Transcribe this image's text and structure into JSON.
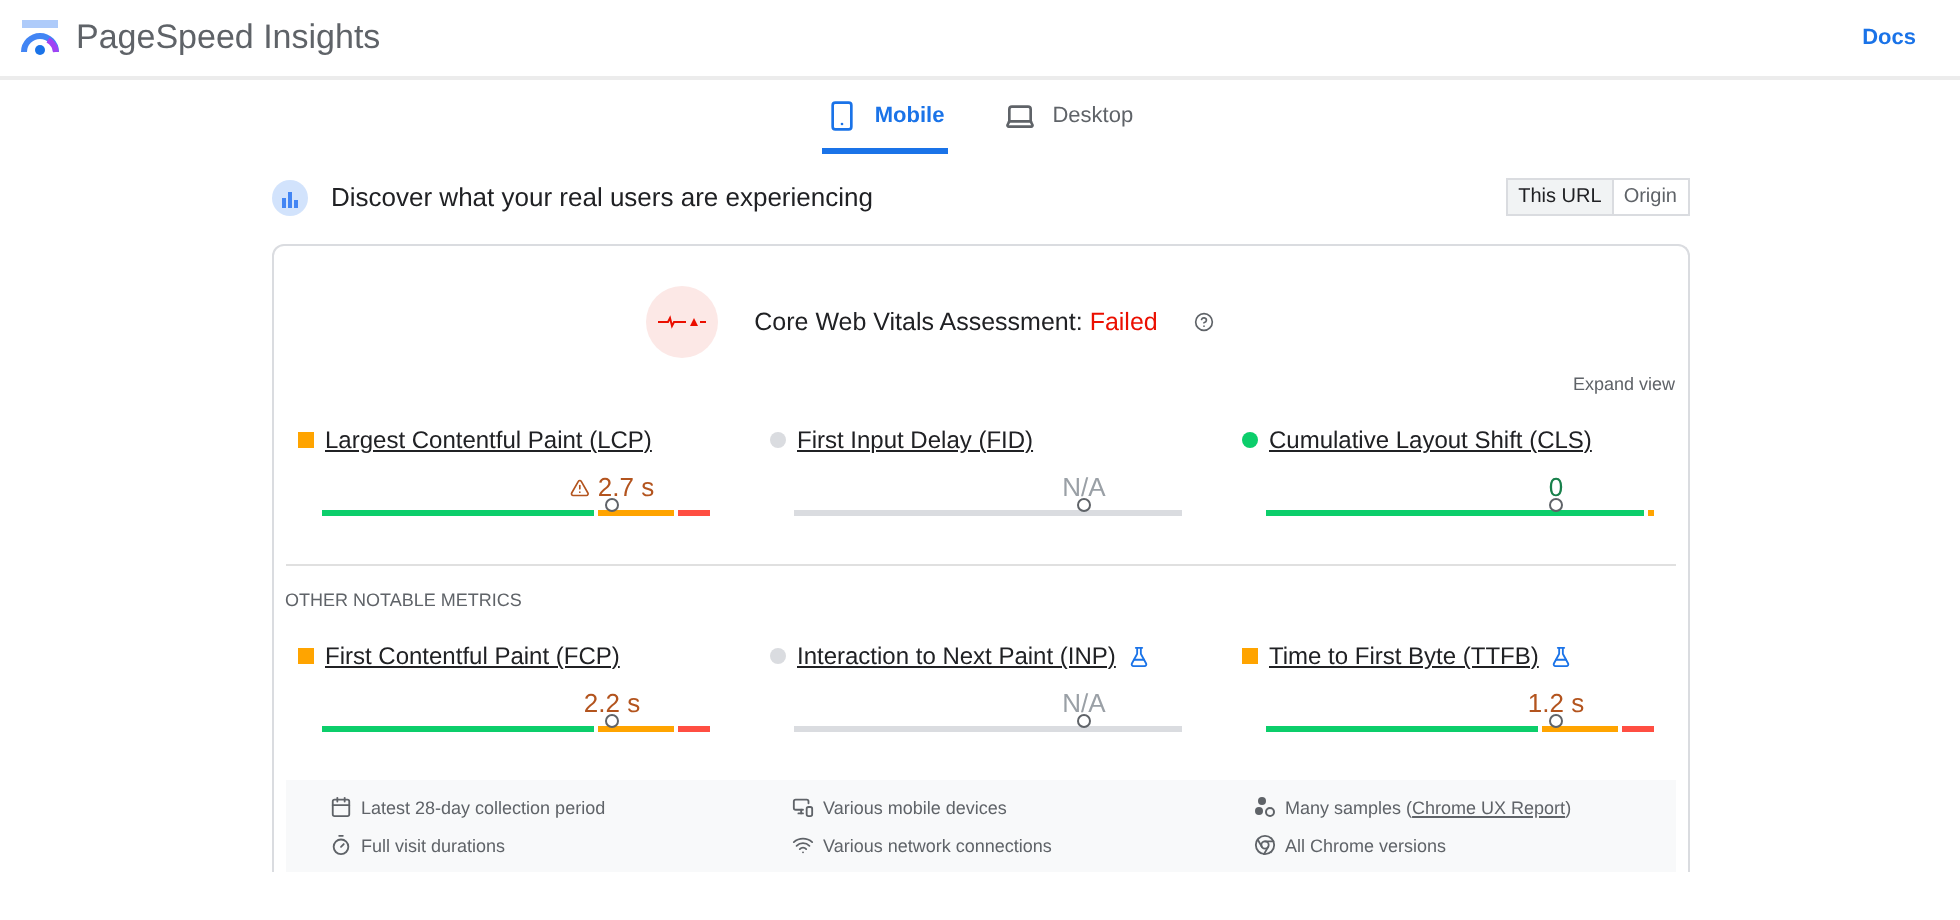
{
  "header": {
    "title": "PageSpeed Insights",
    "docs_link": "Docs"
  },
  "tabs": [
    {
      "label": "Mobile",
      "kind": "mobile",
      "selected": true
    },
    {
      "label": "Desktop",
      "kind": "desktop",
      "selected": false
    }
  ],
  "discover": {
    "heading": "Discover what your real users are experiencing",
    "scope": [
      {
        "label": "This URL",
        "selected": true
      },
      {
        "label": "Origin",
        "selected": false
      }
    ]
  },
  "assessment": {
    "label": "Core Web Vitals Assessment:",
    "result": "Failed",
    "passed": false,
    "expand": "Expand view"
  },
  "core_metrics": [
    {
      "name": "Largest Contentful Paint (LCP)",
      "color": "#ffa400",
      "warning": true,
      "value": "2.7 s",
      "segments": [
        {
          "color": "#0cce6b"
        },
        {
          "color": "#ffa400"
        },
        {
          "color": "#ff4e42"
        }
      ]
    },
    {
      "name": "First Input Delay (FID)",
      "color": "#dadce0",
      "value": "N/A",
      "segments": [
        {
          "color": "#dadce0"
        }
      ]
    },
    {
      "name": "Cumulative Layout Shift (CLS)",
      "color": "#0cce6b",
      "value": "0",
      "segments": [
        {
          "color": "#0cce6b"
        },
        {
          "color": "#ffa400"
        }
      ]
    }
  ],
  "other_heading": "OTHER NOTABLE METRICS",
  "other_metrics": [
    {
      "name": "First Contentful Paint (FCP)",
      "color": "#ffa400",
      "value": "2.2 s",
      "segments": [
        {
          "color": "#0cce6b"
        },
        {
          "color": "#ffa400"
        },
        {
          "color": "#ff4e42"
        }
      ]
    },
    {
      "name": "Interaction to Next Paint (INP)",
      "color": "#dadce0",
      "experimental": true,
      "value": "N/A",
      "segments": [
        {
          "color": "#dadce0"
        }
      ]
    },
    {
      "name": "Time to First Byte (TTFB)",
      "color": "#ffa400",
      "experimental": true,
      "value": "1.2 s",
      "segments": [
        {
          "color": "#0cce6b"
        },
        {
          "color": "#ffa400"
        },
        {
          "color": "#ff4e42"
        }
      ]
    }
  ],
  "facts": [
    {
      "kind": "calendar",
      "text": "Latest 28-day collection period"
    },
    {
      "kind": "devices",
      "text": "Various mobile devices"
    },
    {
      "kind": "samples",
      "text": "Many samples (",
      "link": "Chrome UX Report",
      "after": ")"
    },
    {
      "kind": "timer",
      "text": "Full visit durations"
    },
    {
      "kind": "wifi",
      "text": "Various network connections"
    },
    {
      "kind": "chrome",
      "text": "All Chrome versions"
    }
  ]
}
